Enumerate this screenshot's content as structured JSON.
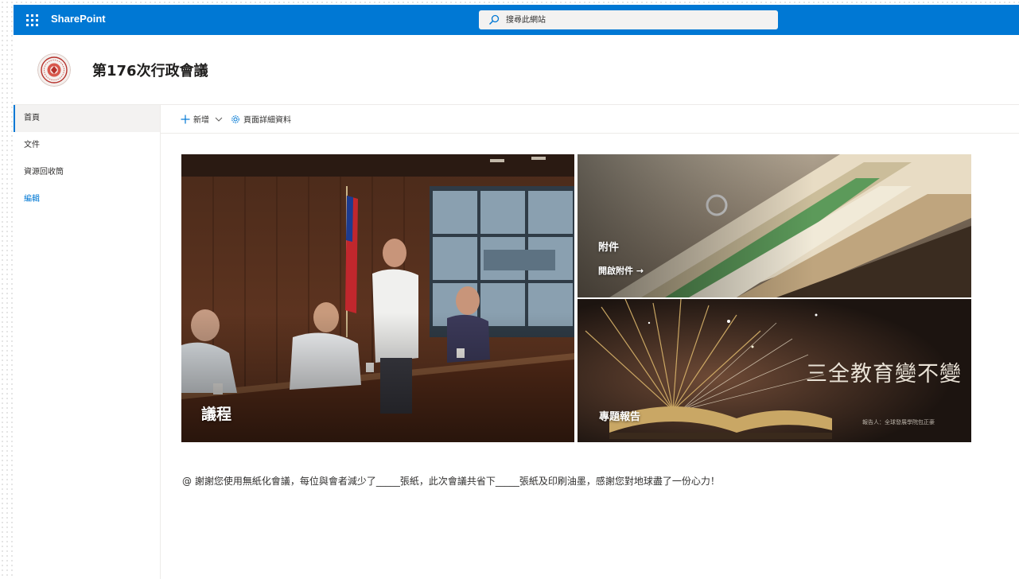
{
  "suitebar": {
    "app_name": "SharePoint",
    "search_placeholder": "搜尋此網站",
    "accent_color": "#0078d4"
  },
  "site": {
    "title": "第176次行政會議",
    "logo_icon": "seal-logo-icon"
  },
  "nav": {
    "items": [
      {
        "label": "首頁",
        "selected": true
      },
      {
        "label": "文件",
        "selected": false
      },
      {
        "label": "資源回收筒",
        "selected": false
      }
    ],
    "edit_label": "編輯"
  },
  "commandbar": {
    "new_label": "新增",
    "page_details_label": "頁面詳細資料"
  },
  "hero": {
    "agenda": {
      "title": "議程"
    },
    "attachments": {
      "title": "附件",
      "link_label": "開啟附件",
      "link_arrow": "→"
    },
    "report": {
      "title": "專題報告",
      "image_text": "三全教育變不變",
      "image_caption": "報告人：全球發展學院包正豪"
    }
  },
  "footer": {
    "message": "@ 謝謝您使用無紙化會議，每位與會者減少了_____張紙，此次會議共省下_____張紙及印刷油墨，感謝您對地球盡了一份心力！"
  }
}
